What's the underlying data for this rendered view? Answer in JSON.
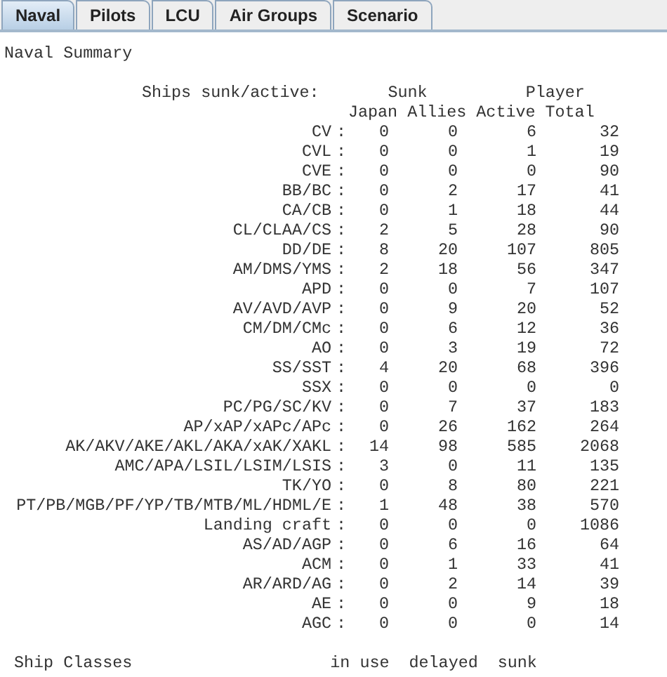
{
  "tabs": [
    {
      "label": "Naval",
      "selected": true
    },
    {
      "label": "Pilots",
      "selected": false
    },
    {
      "label": "LCU",
      "selected": false
    },
    {
      "label": "Air Groups",
      "selected": false
    },
    {
      "label": "Scenario",
      "selected": false
    }
  ],
  "report": {
    "title": "Naval Summary",
    "header": {
      "label": "Ships sunk/active:",
      "group_1": "Sunk",
      "group_2": "Player",
      "columns": [
        "Japan",
        "Allies",
        "Active",
        "Total"
      ]
    },
    "separator": ":",
    "rows": [
      {
        "name": "CV",
        "values": [
          "0",
          "0",
          "6",
          "32"
        ]
      },
      {
        "name": "CVL",
        "values": [
          "0",
          "0",
          "1",
          "19"
        ]
      },
      {
        "name": "CVE",
        "values": [
          "0",
          "0",
          "0",
          "90"
        ]
      },
      {
        "name": "BB/BC",
        "values": [
          "0",
          "2",
          "17",
          "41"
        ]
      },
      {
        "name": "CA/CB",
        "values": [
          "0",
          "1",
          "18",
          "44"
        ]
      },
      {
        "name": "CL/CLAA/CS",
        "values": [
          "2",
          "5",
          "28",
          "90"
        ]
      },
      {
        "name": "DD/DE",
        "values": [
          "8",
          "20",
          "107",
          "805"
        ]
      },
      {
        "name": "AM/DMS/YMS",
        "values": [
          "2",
          "18",
          "56",
          "347"
        ]
      },
      {
        "name": "APD",
        "values": [
          "0",
          "0",
          "7",
          "107"
        ]
      },
      {
        "name": "AV/AVD/AVP",
        "values": [
          "0",
          "9",
          "20",
          "52"
        ]
      },
      {
        "name": "CM/DM/CMc",
        "values": [
          "0",
          "6",
          "12",
          "36"
        ]
      },
      {
        "name": "AO",
        "values": [
          "0",
          "3",
          "19",
          "72"
        ]
      },
      {
        "name": "SS/SST",
        "values": [
          "4",
          "20",
          "68",
          "396"
        ]
      },
      {
        "name": "SSX",
        "values": [
          "0",
          "0",
          "0",
          "0"
        ]
      },
      {
        "name": "PC/PG/SC/KV",
        "values": [
          "0",
          "7",
          "37",
          "183"
        ]
      },
      {
        "name": "AP/xAP/xAPc/APc",
        "values": [
          "0",
          "26",
          "162",
          "264"
        ]
      },
      {
        "name": "AK/AKV/AKE/AKL/AKA/xAK/XAKL",
        "values": [
          "14",
          "98",
          "585",
          "2068"
        ]
      },
      {
        "name": "AMC/APA/LSIL/LSIM/LSIS",
        "values": [
          "3",
          "0",
          "11",
          "135"
        ]
      },
      {
        "name": "TK/YO",
        "values": [
          "0",
          "8",
          "80",
          "221"
        ]
      },
      {
        "name": "PT/PB/MGB/PF/YP/TB/MTB/ML/HDML/E",
        "values": [
          "1",
          "48",
          "38",
          "570"
        ]
      },
      {
        "name": "Landing craft",
        "values": [
          "0",
          "0",
          "0",
          "1086"
        ]
      },
      {
        "name": "AS/AD/AGP",
        "values": [
          "0",
          "6",
          "16",
          "64"
        ]
      },
      {
        "name": "ACM",
        "values": [
          "0",
          "1",
          "33",
          "41"
        ]
      },
      {
        "name": "AR/ARD/AG",
        "values": [
          "0",
          "2",
          "14",
          "39"
        ]
      },
      {
        "name": "AE",
        "values": [
          "0",
          "0",
          "9",
          "18"
        ]
      },
      {
        "name": "AGC",
        "values": [
          "0",
          "0",
          "0",
          "14"
        ]
      }
    ],
    "classes_header": {
      "label": "Ship Classes",
      "columns": [
        "in use",
        "delayed",
        "sunk"
      ]
    }
  }
}
